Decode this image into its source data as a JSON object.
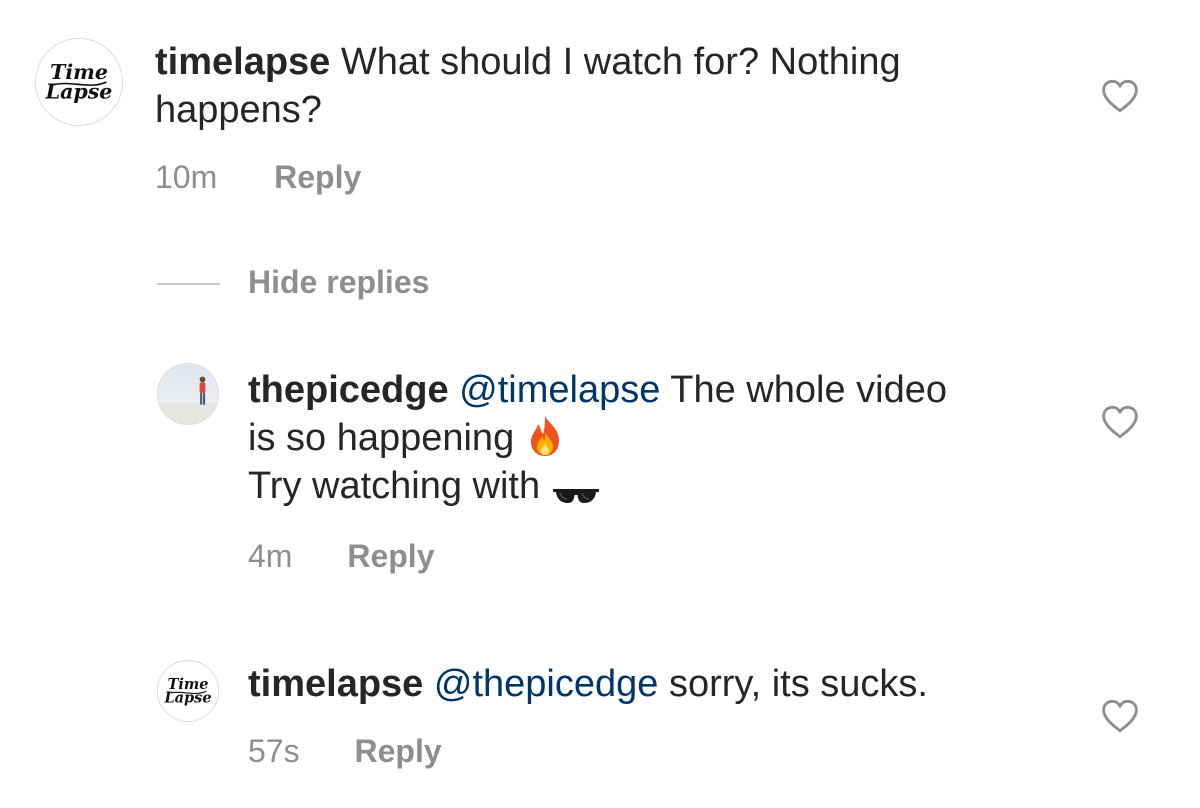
{
  "comments": [
    {
      "username": "timelapse",
      "text_line1": "What should I watch for? Nothing",
      "text_line2": "happens?",
      "time": "10m",
      "reply_label": "Reply",
      "avatar_text_top": "Time",
      "avatar_text_bottom": "Lapse"
    }
  ],
  "replies_toggle": {
    "label": "Hide replies"
  },
  "replies": [
    {
      "username": "thepicedge",
      "mention": "@timelapse",
      "text_after_mention": "The whole video",
      "text_line2": "is so happening",
      "text_line3": "Try watching with",
      "emoji_line2": "fire-emoji",
      "emoji_line3": "sunglasses-emoji",
      "time": "4m",
      "reply_label": "Reply"
    },
    {
      "username": "timelapse",
      "mention": "@thepicedge",
      "text_after_mention": "sorry, its sucks.",
      "time": "57s",
      "reply_label": "Reply",
      "avatar_text_top": "Time",
      "avatar_text_bottom": "Lapse"
    }
  ],
  "colors": {
    "text": "#262626",
    "secondary": "#8e8e8e",
    "mention": "#003569",
    "divider": "#c7c7c7"
  },
  "icons": {
    "like": "heart-outline-icon"
  }
}
